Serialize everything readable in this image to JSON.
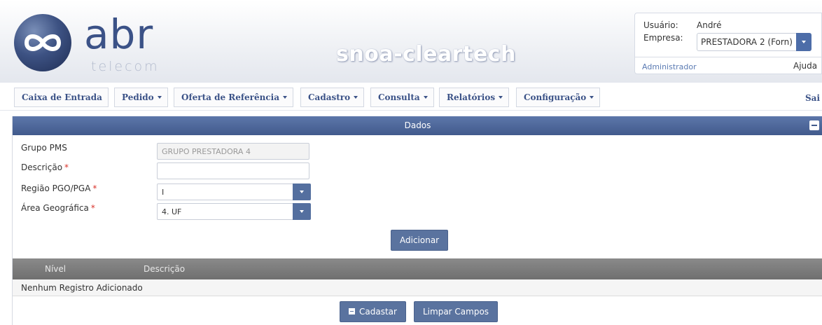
{
  "header": {
    "logo_text": "abr",
    "logo_subtext": "telecom",
    "app_title": "snoa-cleartech",
    "user_label": "Usuário:",
    "user_value": "André",
    "company_label": "Empresa:",
    "company_value": "PRESTADORA 2 (Forn)",
    "role_link": "Administrador",
    "help_link": "Ajuda"
  },
  "nav": {
    "items": [
      {
        "label": "Caixa de Entrada",
        "dropdown": false
      },
      {
        "label": "Pedido",
        "dropdown": true
      },
      {
        "label": "Oferta de Referência",
        "dropdown": true
      },
      {
        "label": "Cadastro",
        "dropdown": true
      },
      {
        "label": "Consulta",
        "dropdown": true
      },
      {
        "label": "Relatórios",
        "dropdown": true
      },
      {
        "label": "Configuração",
        "dropdown": true
      }
    ],
    "exit_label": "Sai"
  },
  "panel": {
    "title": "Dados",
    "fields": {
      "grupo_pms_label": "Grupo PMS",
      "grupo_pms_value": "GRUPO PRESTADORA 4",
      "descricao_label": "Descrição",
      "descricao_value": "",
      "regiao_label": "Região PGO/PGA",
      "regiao_value": "I",
      "area_label": "Área Geográfica",
      "area_value": "4. UF",
      "required_mark": "*"
    },
    "add_button": "Adicionar",
    "table": {
      "columns": [
        "Nível",
        "Descrição"
      ],
      "empty_message": "Nenhum Registro Adicionado"
    },
    "save_button": "Cadastar",
    "clear_button": "Limpar Campos"
  },
  "colors": {
    "brand": "#3b5287",
    "panel_header": "#4d669a",
    "button": "#5a739f",
    "required": "#d9332b"
  }
}
